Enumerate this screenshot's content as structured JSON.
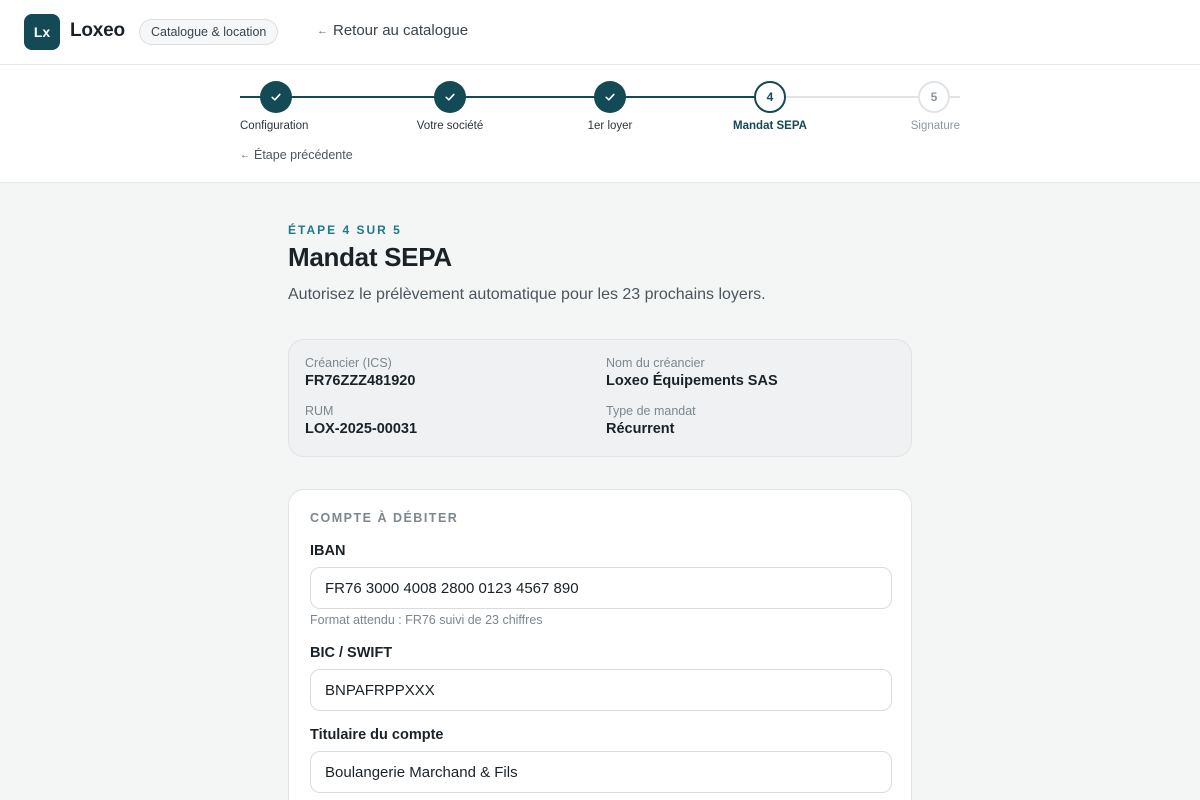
{
  "app": {
    "logo_text": "Lx",
    "name": "Loxeo",
    "section_pill": "Catalogue & location",
    "back_link": "Retour au catalogue",
    "back_arrow": "←"
  },
  "stepper": {
    "steps": [
      {
        "label": "Configuration",
        "status": "done",
        "number": "1"
      },
      {
        "label": "Votre société",
        "status": "done",
        "number": "2"
      },
      {
        "label": "1er loyer",
        "status": "done",
        "number": "3"
      },
      {
        "label": "Mandat SEPA",
        "status": "current",
        "number": "4"
      },
      {
        "label": "Signature",
        "status": "todo",
        "number": "5"
      }
    ],
    "prev_step_label": "Étape précédente",
    "prev_arrow": "←"
  },
  "page": {
    "eyebrow": "ÉTAPE 4 SUR 5",
    "title": "Mandat SEPA",
    "subtitle": "Autorisez le prélèvement automatique pour les 23 prochains loyers."
  },
  "summary": {
    "creditor_id_label": "Créancier (ICS)",
    "creditor_id_value": "FR76ZZZ481920",
    "creditor_name_label": "Nom du créancier",
    "creditor_name_value": "Loxeo Équipements SAS",
    "rum_label": "RUM",
    "rum_value": "LOX-2025-00031",
    "mandate_type_label": "Type de mandat",
    "mandate_type_value": "Récurrent"
  },
  "account": {
    "heading": "COMPTE À DÉBITER",
    "iban_label": "IBAN",
    "iban_value": "FR76 3000 4008 2800 0123 4567 890",
    "iban_hint": "Format attendu : FR76 suivi de 23 chiffres",
    "bic_label": "BIC / SWIFT",
    "bic_value": "BNPAFRPPXXX",
    "holder_label": "Titulaire du compte",
    "holder_value": "Boulangerie Marchand & Fils"
  },
  "colors": {
    "brand": "#134a55",
    "accent": "#1f7a87"
  }
}
